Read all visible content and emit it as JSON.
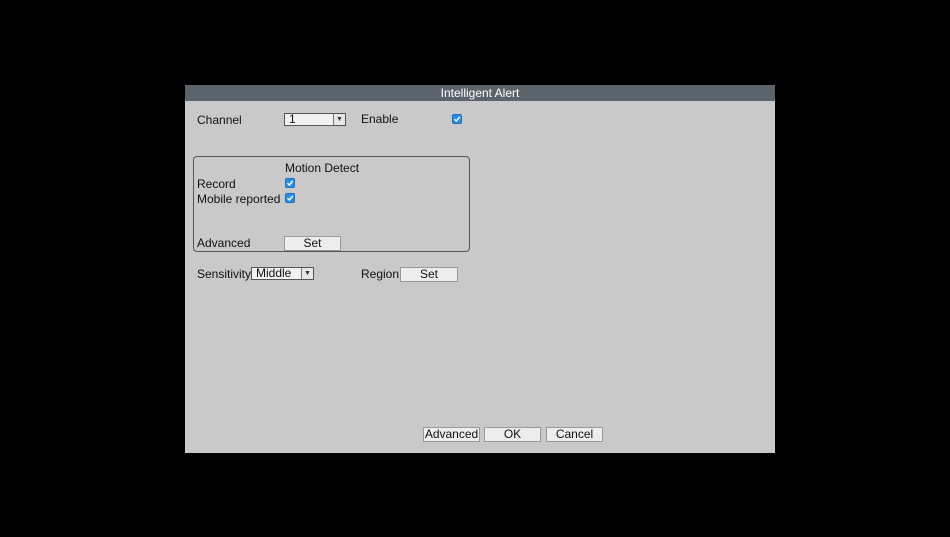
{
  "dialog": {
    "title": "Intelligent Alert",
    "channel_label": "Channel",
    "channel_value": "1",
    "enable_label": "Enable",
    "enable_checked": true,
    "group": {
      "title": "Motion Detect",
      "record_label": "Record",
      "record_checked": true,
      "mobile_label": "Mobile reported",
      "mobile_checked": true,
      "advanced_label": "Advanced",
      "set_label": "Set"
    },
    "sensitivity_label": "Sensitivity",
    "sensitivity_value": "Middle",
    "region_label": "Region",
    "region_set_label": "Set",
    "footer": {
      "advanced_label": "Advanced",
      "ok_label": "OK",
      "cancel_label": "Cancel"
    }
  },
  "colors": {
    "background": "#000000",
    "dialog_bg": "#c9c9c9",
    "titlebar_bg": "#5b646c",
    "checkbox": "#2a8fe6"
  },
  "icons": {
    "dropdown": "chevron-down-icon",
    "checkbox": "checkmark-icon"
  }
}
